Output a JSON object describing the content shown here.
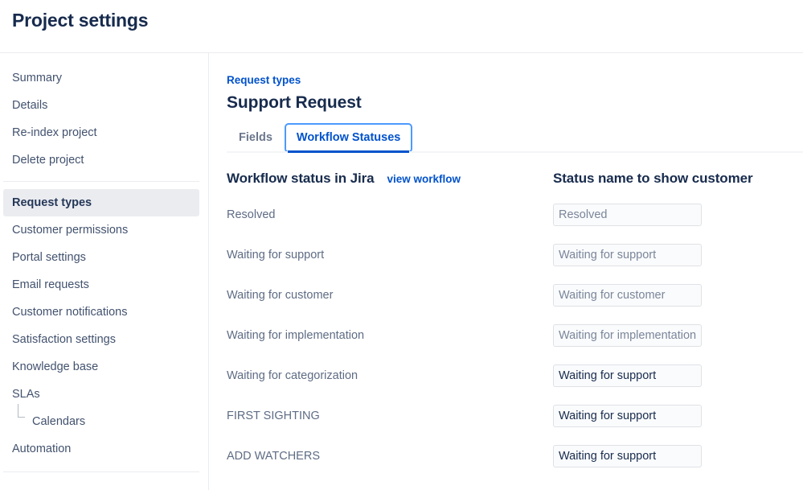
{
  "header": {
    "title": "Project settings"
  },
  "sidebar": {
    "groups": [
      {
        "items": [
          {
            "label": "Summary",
            "selected": false,
            "child": false
          },
          {
            "label": "Details",
            "selected": false,
            "child": false
          },
          {
            "label": "Re-index project",
            "selected": false,
            "child": false
          },
          {
            "label": "Delete project",
            "selected": false,
            "child": false
          }
        ]
      },
      {
        "items": [
          {
            "label": "Request types",
            "selected": true,
            "child": false
          },
          {
            "label": "Customer permissions",
            "selected": false,
            "child": false
          },
          {
            "label": "Portal settings",
            "selected": false,
            "child": false
          },
          {
            "label": "Email requests",
            "selected": false,
            "child": false
          },
          {
            "label": "Customer notifications",
            "selected": false,
            "child": false
          },
          {
            "label": "Satisfaction settings",
            "selected": false,
            "child": false
          },
          {
            "label": "Knowledge base",
            "selected": false,
            "child": false
          },
          {
            "label": "SLAs",
            "selected": false,
            "child": false
          },
          {
            "label": "Calendars",
            "selected": false,
            "child": true
          },
          {
            "label": "Automation",
            "selected": false,
            "child": false
          }
        ]
      }
    ]
  },
  "main": {
    "breadcrumb": "Request types",
    "title": "Support Request",
    "tabs": [
      {
        "label": "Fields",
        "active": false
      },
      {
        "label": "Workflow Statuses",
        "active": true
      }
    ],
    "table": {
      "col_jira_header": "Workflow status in Jira",
      "view_workflow_label": "view workflow",
      "col_customer_header": "Status name to show customer",
      "rows": [
        {
          "jira_status": "Resolved",
          "customer_name": "",
          "placeholder": "Resolved"
        },
        {
          "jira_status": "Waiting for support",
          "customer_name": "",
          "placeholder": "Waiting for support"
        },
        {
          "jira_status": "Waiting for customer",
          "customer_name": "",
          "placeholder": "Waiting for customer"
        },
        {
          "jira_status": "Waiting for implementation",
          "customer_name": "",
          "placeholder": "Waiting for implementation"
        },
        {
          "jira_status": "Waiting for categorization",
          "customer_name": "Waiting for support",
          "placeholder": ""
        },
        {
          "jira_status": "FIRST SIGHTING",
          "customer_name": "Waiting for support",
          "placeholder": ""
        },
        {
          "jira_status": "ADD WATCHERS",
          "customer_name": "Waiting for support",
          "placeholder": ""
        }
      ]
    }
  },
  "colors": {
    "accent": "#0052cc",
    "focus_ring": "#4c9aff",
    "text_primary": "#172b4d",
    "text_muted": "#5e6c84",
    "selected_bg": "#ebecf0"
  }
}
